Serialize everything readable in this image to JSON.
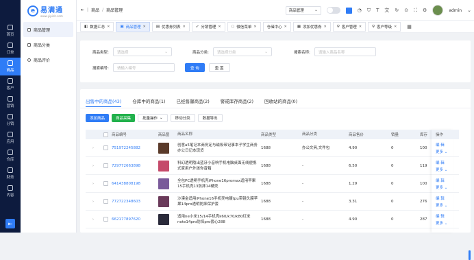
{
  "sidebar": {
    "items": [
      {
        "label": "首页",
        "icon": "home-icon"
      },
      {
        "label": "订单",
        "icon": "order-icon"
      },
      {
        "label": "商品",
        "icon": "goods-icon",
        "active": true
      },
      {
        "label": "客户",
        "icon": "customer-icon"
      },
      {
        "label": "营销",
        "icon": "marketing-icon"
      },
      {
        "label": "分销",
        "icon": "distribution-icon"
      },
      {
        "label": "应用",
        "icon": "apps-icon"
      },
      {
        "label": "仓库",
        "icon": "warehouse-icon"
      },
      {
        "label": "财务",
        "icon": "finance-icon"
      },
      {
        "label": "内容",
        "icon": "content-icon"
      }
    ],
    "collapse_glyph": "⇤"
  },
  "brand": {
    "name": "易满通",
    "url": "www.yipinh.com"
  },
  "submenu": {
    "items": [
      {
        "label": "商品管理",
        "active": true
      },
      {
        "label": "商品分类"
      },
      {
        "label": "商品评价"
      }
    ]
  },
  "header": {
    "breadcrumb": [
      "商品",
      "商品管理"
    ],
    "select_value": "商品管理",
    "user": "admin"
  },
  "tabs": [
    {
      "label": "数据汇总"
    },
    {
      "label": "商品管理",
      "active": true
    },
    {
      "label": "优惠券列表"
    },
    {
      "label": "分销管理"
    },
    {
      "label": "微信菜单"
    },
    {
      "label": "仓储中心"
    },
    {
      "label": "添加优惠券"
    },
    {
      "label": "客户管理"
    },
    {
      "label": "客户等级"
    }
  ],
  "filter": {
    "type_label": "商品类型:",
    "type_placeholder": "请选择",
    "category_label": "商品分类:",
    "category_placeholder": "请选择分类",
    "name_label": "搜索名称:",
    "name_placeholder": "请输入商品名称",
    "code_label": "搜索编号:",
    "code_placeholder": "请输入编号",
    "search_label": "查 询",
    "reset_label": "重 置"
  },
  "status_tabs": [
    {
      "label": "出售中的商品(43)",
      "active": true
    },
    {
      "label": "仓库中的商品(1)"
    },
    {
      "label": "已经售馨商品(2)"
    },
    {
      "label": "警戒库存商品(2)"
    },
    {
      "label": "回收站的商品(0)"
    }
  ],
  "actions": {
    "add": "添加商品",
    "collect": "商品采集",
    "batch": "批量操作",
    "move": "移动分类",
    "export": "数据导出"
  },
  "table": {
    "headers": [
      "商品编号",
      "商品图",
      "商品名称",
      "商品类型",
      "商品分类",
      "商品售价",
      "销量",
      "库存"
    ],
    "ops_header": "操作",
    "rows": [
      {
        "id": "751972245882",
        "name": "创意a5笔记本商务定与磁吸带记事本子学生商务办公日记本现货",
        "type": "1688",
        "category": "办公文具,文件包",
        "price": "4.90",
        "sales": "0",
        "stock": "100",
        "thumb": "#5a3a2a"
      },
      {
        "id": "729772663898",
        "name": "科幻透明隐出蓝牙小音响手机电脑桌面无线便携式家用户外迷你音箱",
        "type": "1688",
        "category": "-",
        "price": "6.50",
        "sales": "0",
        "stock": "119",
        "thumb": "#c54a6a"
      },
      {
        "id": "641438808198",
        "name": "全包PC透明手机壳iPhone16promax适用苹果15手机壳13防摔14硬壳",
        "type": "1688",
        "category": "-",
        "price": "1.29",
        "sales": "0",
        "stock": "100",
        "thumb": "#7a5a9a"
      },
      {
        "id": "772722348603",
        "name": "沙漠金适用iPhone16手机壳电镀tpu带镜头膜苹果14pro透明防摔保护套",
        "type": "1688",
        "category": "-",
        "price": "3.31",
        "sales": "0",
        "stock": "276",
        "thumb": "#6a3a5a"
      },
      {
        "id": "662177897620",
        "name": "适用ne小米15/14手机壳k60/k70/k80红米note14pro防摔pro套心288",
        "type": "1688",
        "category": "-",
        "price": "4.90",
        "sales": "0",
        "stock": "287",
        "thumb": "#2a2a3a"
      }
    ],
    "op_edit": "编 辑",
    "op_more": "更多"
  }
}
